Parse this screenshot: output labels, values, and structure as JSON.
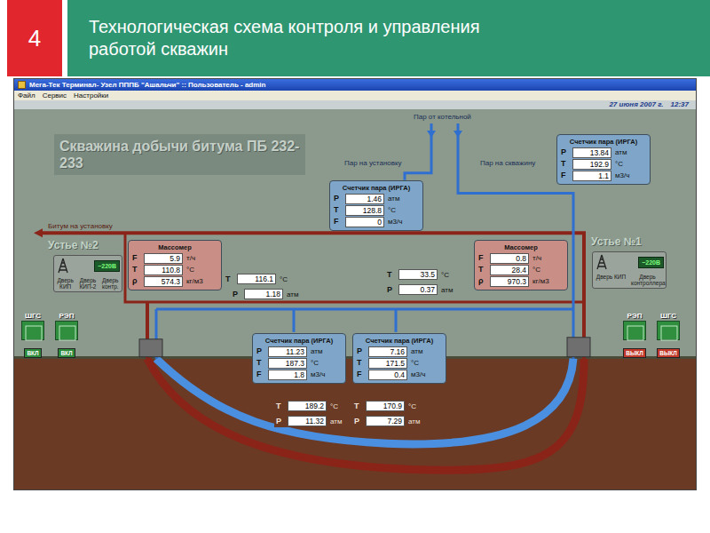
{
  "slide": {
    "number": "4",
    "title": "Технологическая схема контроля и управления работой скважин"
  },
  "window": {
    "title": "Мега-Тек Терминал- Узел ПППБ \"Ашальчи\" :: Пользователь - admin",
    "menu": [
      "Файл",
      "Сервис",
      "Настройки"
    ],
    "date": "27 июня 2007 г.",
    "time": "12:37"
  },
  "diagram": {
    "title": "Скважина добычи битума ПБ 232-233",
    "labels": {
      "steam_from_boiler": "Пар от котельной",
      "steam_to_plant": "Пар на установку",
      "steam_to_well": "Пар на скважину",
      "bitumen_to_plant": "Битум на установку"
    },
    "wellheads": [
      {
        "name": "Устье №2",
        "power": "~220В",
        "doors": [
          "Дверь КИП",
          "Дверь КИП-2",
          "Дверь контр."
        ]
      },
      {
        "name": "Устье №1",
        "power": "~220В",
        "doors": [
          "Дверь КИП",
          "Дверь контроллера"
        ]
      }
    ],
    "mass_meters": [
      {
        "title": "Массомер",
        "rows": [
          {
            "sym": "F",
            "value": "5.9",
            "unit": "т/ч"
          },
          {
            "sym": "T",
            "value": "110.8",
            "unit": "°С"
          },
          {
            "sym": "ρ",
            "value": "574.3",
            "unit": "кг/м3"
          }
        ]
      },
      {
        "title": "Массомер",
        "rows": [
          {
            "sym": "F",
            "value": "0.8",
            "unit": "т/ч"
          },
          {
            "sym": "T",
            "value": "28.4",
            "unit": "°С"
          },
          {
            "sym": "ρ",
            "value": "970.3",
            "unit": "кг/м3"
          }
        ]
      }
    ],
    "steam_meters": [
      {
        "title": "Счетчик пара (ИРГА)",
        "rows": [
          {
            "sym": "P",
            "value": "13.84",
            "unit": "атм"
          },
          {
            "sym": "T",
            "value": "192.9",
            "unit": "°С"
          },
          {
            "sym": "F",
            "value": "1.1",
            "unit": "м3/ч"
          }
        ]
      },
      {
        "title": "Счетчик пара (ИРГА)",
        "rows": [
          {
            "sym": "P",
            "value": "1.46",
            "unit": "атм"
          },
          {
            "sym": "T",
            "value": "128.8",
            "unit": "°С"
          },
          {
            "sym": "F",
            "value": "0",
            "unit": "м3/ч"
          }
        ]
      },
      {
        "title": "Счетчик пара (ИРГА)",
        "rows": [
          {
            "sym": "P",
            "value": "11.23",
            "unit": "атм"
          },
          {
            "sym": "T",
            "value": "187.3",
            "unit": "°С"
          },
          {
            "sym": "F",
            "value": "1.8",
            "unit": "м3/ч"
          }
        ]
      },
      {
        "title": "Счетчик пара (ИРГА)",
        "rows": [
          {
            "sym": "P",
            "value": "7.16",
            "unit": "атм"
          },
          {
            "sym": "T",
            "value": "171.5",
            "unit": "°С"
          },
          {
            "sym": "F",
            "value": "0.4",
            "unit": "м3/ч"
          }
        ]
      }
    ],
    "readings": [
      {
        "sym": "T",
        "value": "116.1",
        "unit": "°С"
      },
      {
        "sym": "P",
        "value": "1.18",
        "unit": "атм"
      },
      {
        "sym": "T",
        "value": "33.5",
        "unit": "°С"
      },
      {
        "sym": "P",
        "value": "0.37",
        "unit": "атм"
      },
      {
        "sym": "T",
        "value": "189.2",
        "unit": "°С"
      },
      {
        "sym": "P",
        "value": "11.32",
        "unit": "атм"
      },
      {
        "sym": "T",
        "value": "170.9",
        "unit": "°С"
      },
      {
        "sym": "P",
        "value": "7.29",
        "unit": "атм"
      }
    ],
    "switches": [
      {
        "label": "ШГС",
        "button": "ВКЛ",
        "on": true
      },
      {
        "label": "РЭП",
        "button": "ВКЛ",
        "on": true
      },
      {
        "label": "РЭП",
        "button": "ВЫКЛ",
        "on": false
      },
      {
        "label": "ШГС",
        "button": "ВЫКЛ",
        "on": false
      }
    ]
  }
}
